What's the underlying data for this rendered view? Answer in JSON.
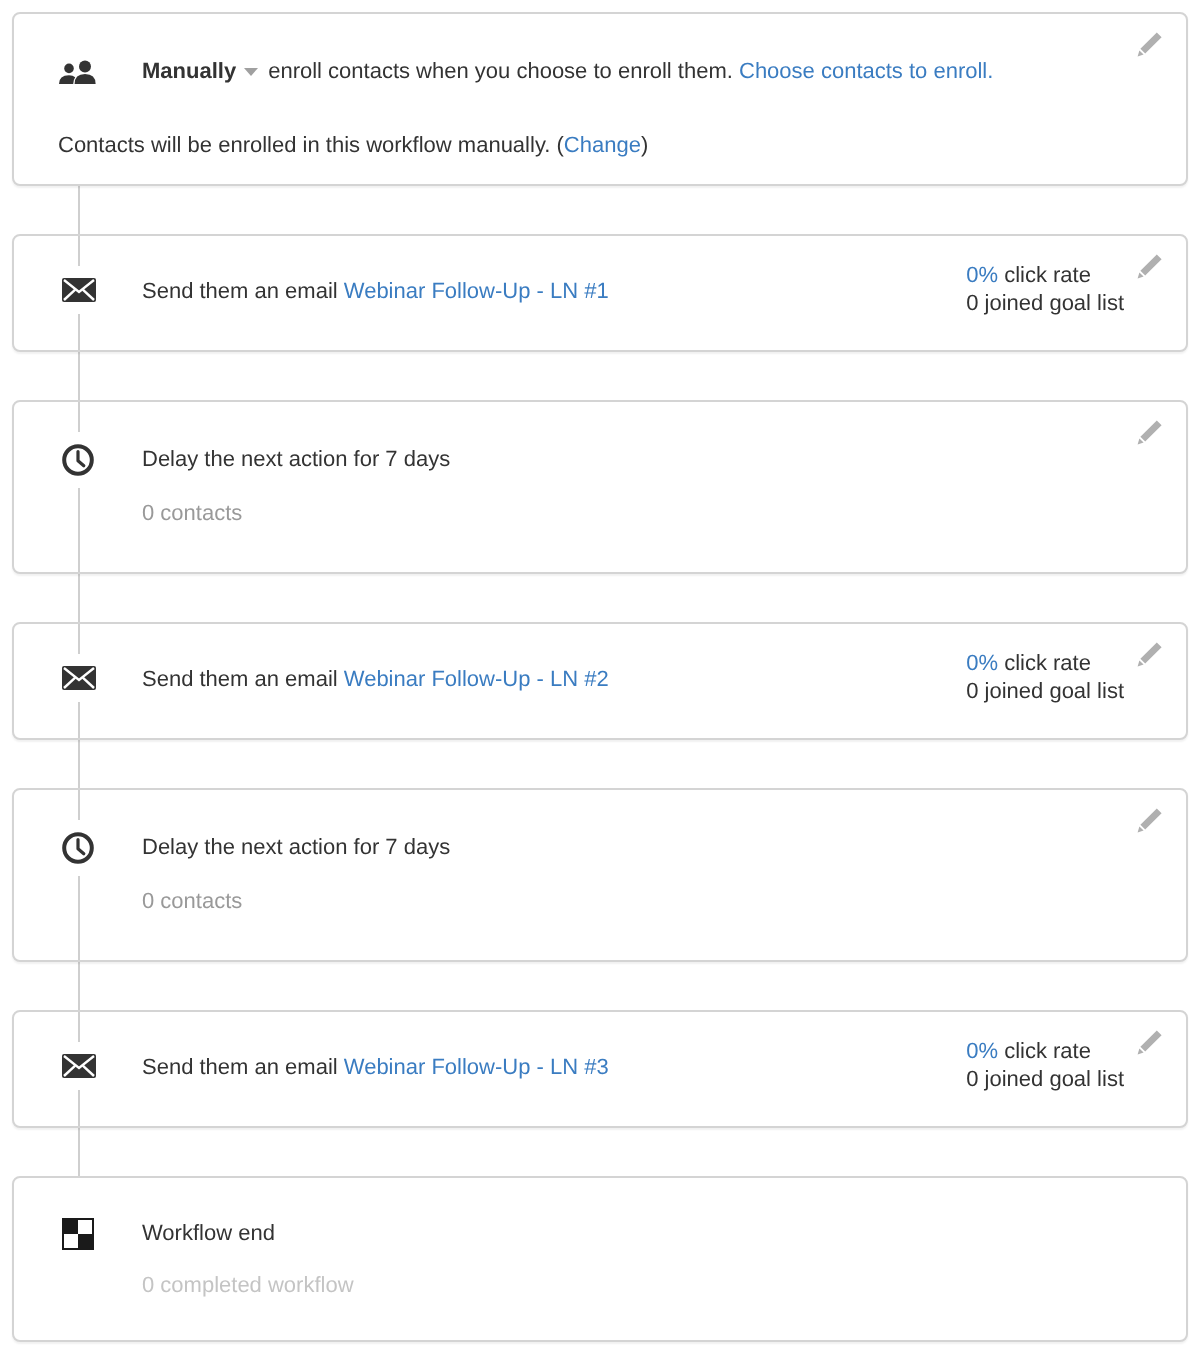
{
  "trigger": {
    "mode": "Manually",
    "description": "enroll contacts when you choose to enroll them.",
    "link": "Choose contacts to enroll.",
    "note": "Contacts will be enrolled in this workflow manually. (",
    "note_link": "Change",
    "note_end": ")"
  },
  "steps": [
    {
      "kind": "email",
      "action": "Send them an email",
      "email_name": "Webinar Follow-Up - LN #1",
      "click_rate": "0%",
      "click_rate_label": "click rate",
      "goal": "0 joined goal list"
    },
    {
      "kind": "delay",
      "title": "Delay the next action for 7 days",
      "count": "0 contacts"
    },
    {
      "kind": "email",
      "action": "Send them an email",
      "email_name": "Webinar Follow-Up - LN #2",
      "click_rate": "0%",
      "click_rate_label": "click rate",
      "goal": "0 joined goal list"
    },
    {
      "kind": "delay",
      "title": "Delay the next action for 7 days",
      "count": "0 contacts"
    },
    {
      "kind": "email",
      "action": "Send them an email",
      "email_name": "Webinar Follow-Up - LN #3",
      "click_rate": "0%",
      "click_rate_label": "click rate",
      "goal": "0 joined goal list"
    },
    {
      "kind": "end",
      "title": "Workflow end",
      "count": "0 completed workflow"
    }
  ]
}
